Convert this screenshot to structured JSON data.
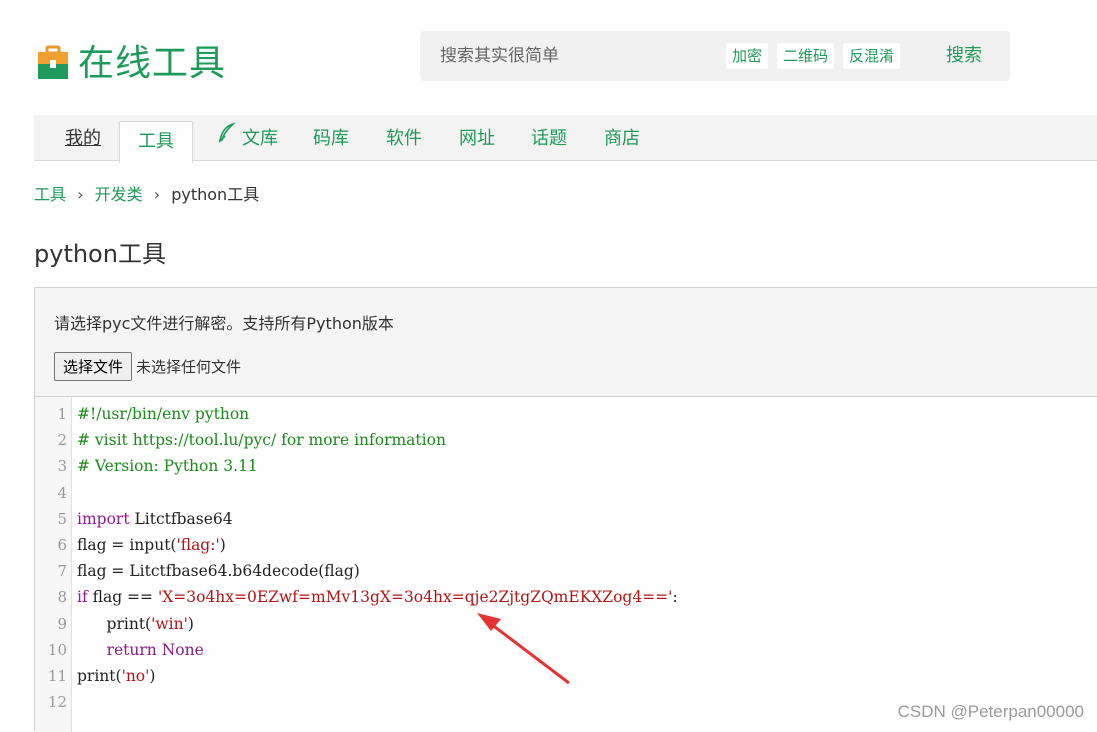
{
  "header": {
    "logo_text": "在线工具",
    "search_placeholder": "搜索其实很简单",
    "chips": [
      "加密",
      "二维码",
      "反混淆"
    ],
    "search_button": "搜索"
  },
  "nav": {
    "items": [
      "我的",
      "工具",
      "文库",
      "码库",
      "软件",
      "网址",
      "话题",
      "商店"
    ]
  },
  "breadcrumb": {
    "items": [
      "工具",
      "开发类",
      "python工具"
    ]
  },
  "page_title": "python工具",
  "panel": {
    "description": "请选择pyc文件进行解密。支持所有Python版本",
    "file_button": "选择文件",
    "file_status": "未选择任何文件"
  },
  "code": {
    "line_numbers": [
      "1",
      "2",
      "3",
      "4",
      "5",
      "6",
      "7",
      "8",
      "9",
      "10",
      "11",
      "12"
    ],
    "lines": [
      [
        {
          "t": "#!/usr/bin/env python",
          "c": "comment"
        }
      ],
      [
        {
          "t": "# visit https://tool.lu/pyc/ for more information",
          "c": "comment"
        }
      ],
      [
        {
          "t": "# Version: Python 3.11",
          "c": "comment"
        }
      ],
      [],
      [
        {
          "t": "import",
          "c": "kw"
        },
        {
          "t": " Litctfbase64",
          "c": "default"
        }
      ],
      [
        {
          "t": "flag = input(",
          "c": "default"
        },
        {
          "t": "'flag:'",
          "c": "str"
        },
        {
          "t": ")",
          "c": "default"
        }
      ],
      [
        {
          "t": "flag = Litctfbase64.b64decode(flag)",
          "c": "default"
        }
      ],
      [
        {
          "t": "if",
          "c": "kw"
        },
        {
          "t": " flag == ",
          "c": "default"
        },
        {
          "t": "'X=3o4hx=0EZwf=mMv13gX=3o4hx=qje2ZjtgZQmEKXZog4=='",
          "c": "str"
        },
        {
          "t": ":",
          "c": "default"
        }
      ],
      [
        {
          "t": "      print(",
          "c": "default"
        },
        {
          "t": "'win'",
          "c": "str"
        },
        {
          "t": ")",
          "c": "default"
        }
      ],
      [
        {
          "t": "      ",
          "c": "default"
        },
        {
          "t": "return",
          "c": "kw"
        },
        {
          "t": " ",
          "c": "default"
        },
        {
          "t": "None",
          "c": "kw"
        }
      ],
      [
        {
          "t": "print(",
          "c": "default"
        },
        {
          "t": "'no'",
          "c": "str"
        },
        {
          "t": ")",
          "c": "default"
        }
      ],
      []
    ]
  },
  "watermark": "CSDN @Peterpan00000",
  "colors": {
    "brand": "#1e9a5a",
    "comment": "#1a8a1a",
    "keyword": "#8b1a8b",
    "string": "#b01515",
    "arrow": "#e53333"
  },
  "icons": {
    "logo": "toolbox-icon",
    "library": "quill-icon"
  }
}
